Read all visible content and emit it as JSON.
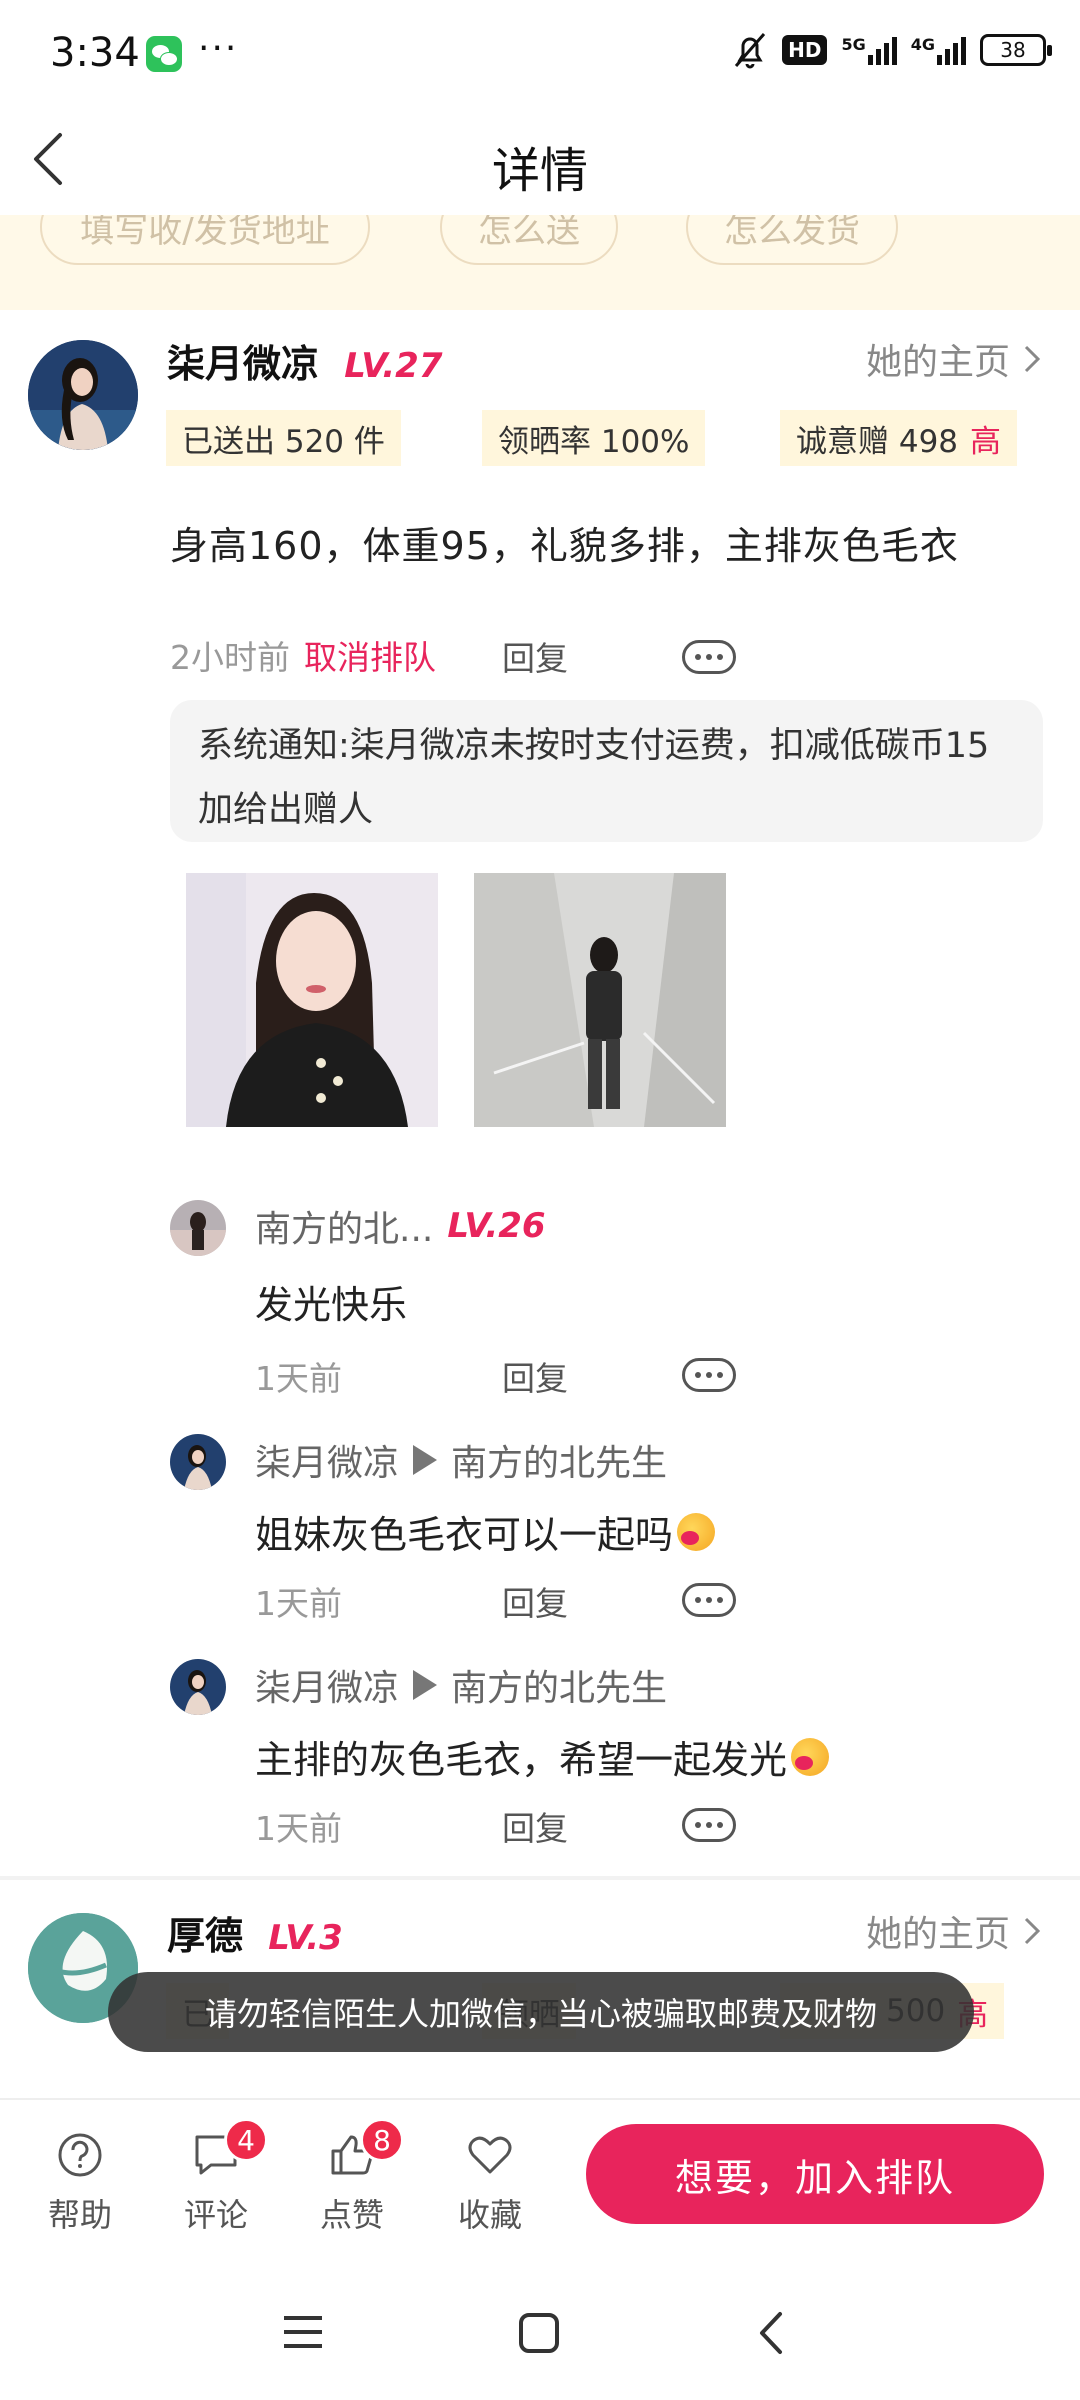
{
  "status_bar": {
    "time": "3:34",
    "dots": "···",
    "hd_label": "HD",
    "net1": "5G",
    "net2": "4G",
    "battery": "38"
  },
  "header": {
    "title": "详情"
  },
  "tip_chips": [
    "填写收/发货地址",
    "怎么送",
    "怎么发货"
  ],
  "post": {
    "username": "柒月微凉",
    "level": "LV.27",
    "homepage_label": "她的主页",
    "stats": {
      "sent": "已送出 520 件",
      "show_rate": "领晒率 100%",
      "sincerity": "诚意赠 498",
      "sincerity_tag": "高"
    },
    "text": "身高160，体重95，礼貌多排，主排灰色毛衣",
    "time": "2小时前",
    "cancel_label": "取消排队",
    "reply_label": "回复",
    "system_notice": "系统通知:柒月微凉未按时支付运费，扣减低碳币15加给出赠人"
  },
  "comments": [
    {
      "name": "南方的北...",
      "level": "LV.26",
      "target": "",
      "text": "发光快乐",
      "emoji": false,
      "time": "1天前",
      "reply_label": "回复"
    },
    {
      "name": "柒月微凉",
      "level": "",
      "target": "南方的北先生",
      "text": "姐妹灰色毛衣可以一起吗",
      "emoji": true,
      "time": "1天前",
      "reply_label": "回复"
    },
    {
      "name": "柒月微凉",
      "level": "",
      "target": "南方的北先生",
      "text": "主排的灰色毛衣，希望一起发光",
      "emoji": true,
      "time": "1天前",
      "reply_label": "回复"
    }
  ],
  "post2": {
    "username": "厚德",
    "level": "LV.3",
    "homepage_label": "她的主页",
    "stat_partial_left": "已",
    "stat_partial_mid": "领晒",
    "stat_partial_right": "500",
    "stat_tag": "高"
  },
  "toast": "请勿轻信陌生人加微信，当心被骗取邮费及财物",
  "bottom_nav": {
    "help": "帮助",
    "comment": "评论",
    "comment_badge": "4",
    "like": "点赞",
    "like_badge": "8",
    "favorite": "收藏",
    "join_button": "想要，加入排队"
  },
  "colors": {
    "accent": "#e8245c",
    "tag_bg": "#fff6dc",
    "tip_bg": "#fff9e8"
  }
}
